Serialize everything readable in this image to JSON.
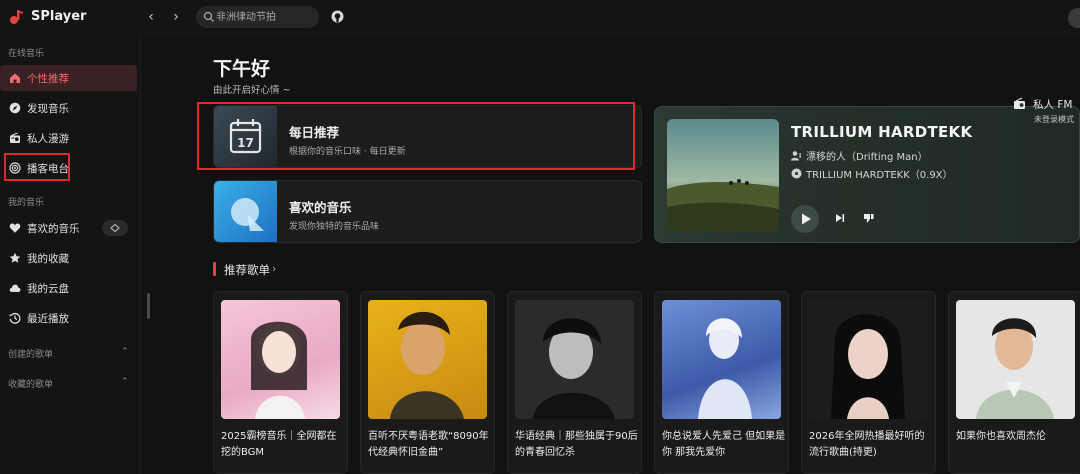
{
  "app": {
    "title": "SPlayer"
  },
  "search": {
    "placeholder": "非洲律动节拍"
  },
  "sidebar": {
    "online_section": "在线音乐",
    "online_items": [
      {
        "label": "个性推荐",
        "icon": "home-icon"
      },
      {
        "label": "发现音乐",
        "icon": "compass-icon"
      },
      {
        "label": "私人漫游",
        "icon": "radio-icon"
      },
      {
        "label": "播客电台",
        "icon": "podcast-icon"
      }
    ],
    "my_section": "我的音乐",
    "my_items": [
      {
        "label": "喜欢的音乐",
        "icon": "heart-icon"
      },
      {
        "label": "我的收藏",
        "icon": "star-icon"
      },
      {
        "label": "我的云盘",
        "icon": "cloud-icon"
      },
      {
        "label": "最近播放",
        "icon": "history-icon"
      }
    ],
    "created_section": "创建的歌单",
    "collected_section": "收藏的歌单"
  },
  "main": {
    "greeting": "下午好",
    "greeting_sub": "由此开启好心情 ~",
    "daily": {
      "title": "每日推荐",
      "subtitle": "根据你的音乐口味 · 每日更新",
      "day": "17"
    },
    "liked": {
      "title": "喜欢的音乐",
      "subtitle": "发现你独特的音乐品味"
    },
    "fm": {
      "song": "TRILLIUM HARDTEKK",
      "artist": "漂移的人（Drifting Man）",
      "album": "TRILLIUM HARDTEKK（0.9X）",
      "name": "私人 FM",
      "login_note": "未登录模式"
    },
    "section_title": "推荐歌单",
    "playlists": [
      {
        "name": "2025霸榜音乐｜全网都在挖的BGM"
      },
      {
        "name": "百听不厌粤语老歌“8090年代经典怀旧金曲”"
      },
      {
        "name": "华语经典｜那些独属于90后的青春回忆杀"
      },
      {
        "name": "你总说爱人先爱己 但如果是你 那我先爱你"
      },
      {
        "name": "2026年全网热播最好听的流行歌曲(持更)"
      },
      {
        "name": "如果你也喜欢周杰伦"
      }
    ]
  },
  "colors": {
    "accent": "#e04545",
    "active_bg": "#3a2224",
    "annotation_red": "#e02a2a"
  }
}
